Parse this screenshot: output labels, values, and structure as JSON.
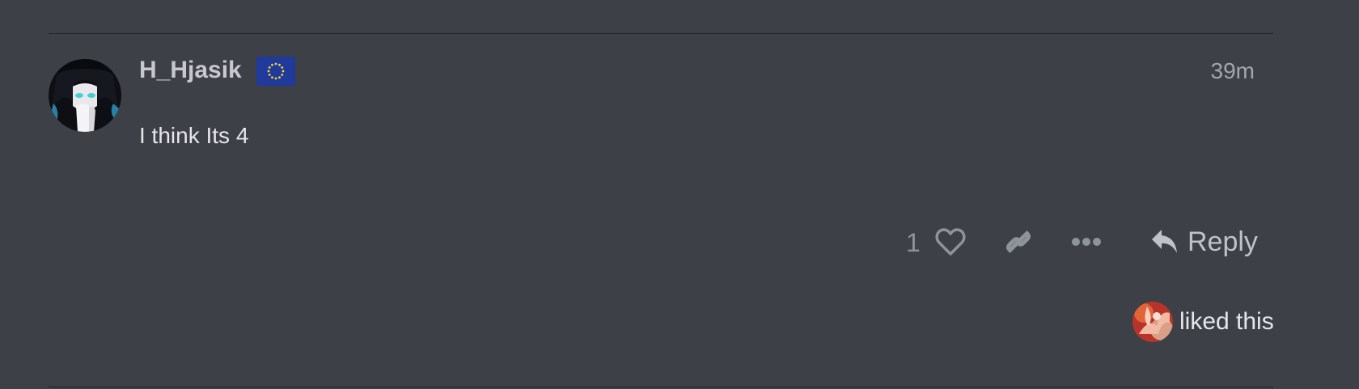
{
  "post": {
    "username": "H_Hjasik",
    "flair_icon": "eu-flag-icon",
    "date": "39m",
    "body": "I think Its 4"
  },
  "actions": {
    "like_count": "1",
    "like_icon": "heart-icon",
    "link_icon": "link-icon",
    "more_icon": "ellipsis-icon",
    "reply_label": "Reply",
    "reply_icon": "reply-icon"
  },
  "liked_by": {
    "text": "liked this"
  },
  "colors": {
    "background": "#3d4047",
    "divider": "#23252a",
    "username": "#c6c8ce",
    "body_text": "#e4e6ea",
    "muted": "#8f939a",
    "flag_blue": "#1f3a9b",
    "flag_star": "#f2d23a"
  }
}
